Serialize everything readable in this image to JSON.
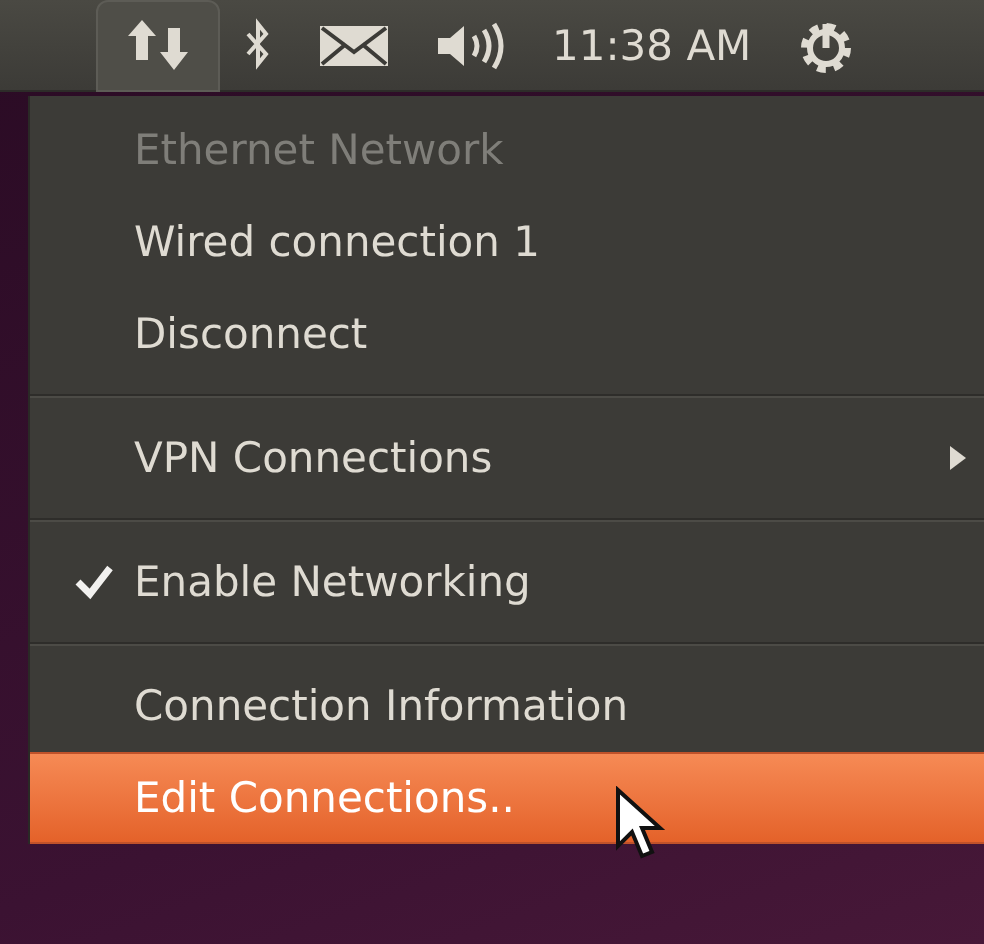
{
  "panel": {
    "clock": "11:38 AM",
    "network_menu_open": true
  },
  "menu": {
    "items": [
      {
        "kind": "item",
        "label": "Ethernet Network",
        "disabled": true,
        "selected": false
      },
      {
        "kind": "item",
        "label": "Wired connection 1",
        "disabled": false,
        "selected": false
      },
      {
        "kind": "item",
        "label": "Disconnect",
        "disabled": false,
        "selected": false
      },
      {
        "kind": "separator"
      },
      {
        "kind": "submenu",
        "label": "VPN Connections",
        "disabled": false,
        "selected": false
      },
      {
        "kind": "separator"
      },
      {
        "kind": "check",
        "label": "Enable Networking",
        "checked": true,
        "disabled": false,
        "selected": false
      },
      {
        "kind": "separator"
      },
      {
        "kind": "item",
        "label": "Connection Information",
        "disabled": false,
        "selected": false
      },
      {
        "kind": "item",
        "label": "Edit Connections..",
        "disabled": false,
        "selected": true
      }
    ]
  }
}
